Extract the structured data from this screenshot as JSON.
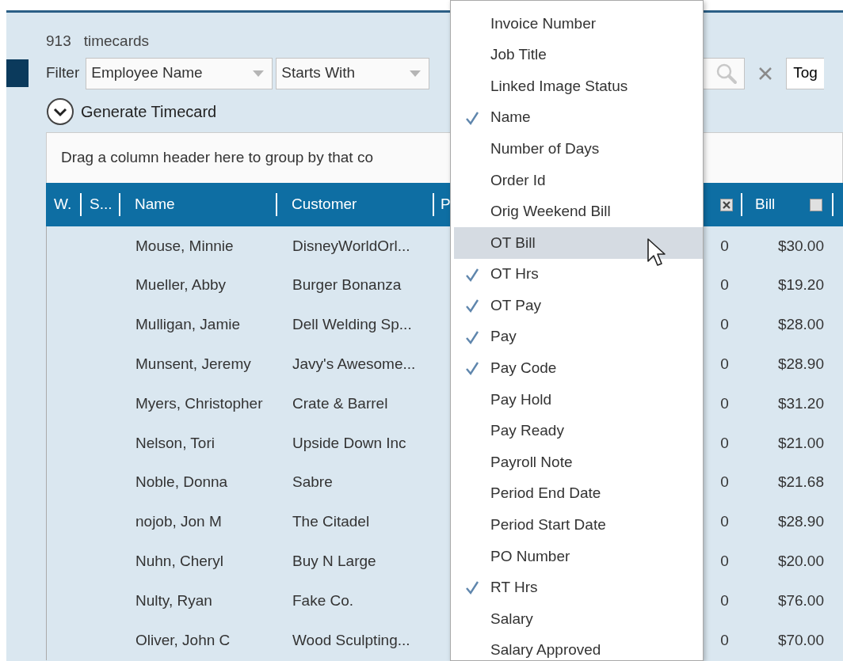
{
  "record_count": {
    "number": "913",
    "label": "timecards"
  },
  "filter": {
    "label": "Filter",
    "field": "Employee Name",
    "operator": "Starts With",
    "toggle_button": "Tog"
  },
  "generate_timecard": {
    "label": "Generate Timecard",
    "expanded": false
  },
  "group_by_hint": "Drag a column header here to group by that co",
  "table": {
    "columns_left": [
      "W.",
      "S...",
      "Name",
      "Customer",
      "P"
    ],
    "columns_right": [
      {
        "kind": "checkbox",
        "checked": true
      },
      {
        "kind": "text",
        "label": "Bill",
        "checked": false
      }
    ],
    "rows": [
      {
        "name": "Mouse, Minnie",
        "customer": "DisneyWorldOrl...",
        "column_6": "0",
        "bill": "$30.00"
      },
      {
        "name": "Mueller, Abby",
        "customer": "Burger Bonanza",
        "column_6": "0",
        "bill": "$19.20"
      },
      {
        "name": "Mulligan, Jamie",
        "customer": "Dell Welding Sp...",
        "column_6": "0",
        "bill": "$28.00"
      },
      {
        "name": "Munsent, Jeremy",
        "customer": "Javy's Awesome...",
        "column_6": "0",
        "bill": "$28.90"
      },
      {
        "name": "Myers, Christopher",
        "customer": "Crate & Barrel",
        "column_6": "0",
        "bill": "$31.20"
      },
      {
        "name": "Nelson, Tori",
        "customer": "Upside Down Inc",
        "column_6": "0",
        "bill": "$21.00"
      },
      {
        "name": "Noble, Donna",
        "customer": "Sabre",
        "column_6": "0",
        "bill": "$21.68"
      },
      {
        "name": "nojob, Jon M",
        "customer": "The Citadel",
        "column_6": "0",
        "bill": "$28.90"
      },
      {
        "name": "Nuhn, Cheryl",
        "customer": "Buy N Large",
        "column_6": "0",
        "bill": "$20.00"
      },
      {
        "name": "Nulty, Ryan",
        "customer": "Fake Co.",
        "column_6": "0",
        "bill": "$76.00"
      },
      {
        "name": "Oliver, John C",
        "customer": "Wood Sculpting...",
        "column_6": "0",
        "bill": "$70.00"
      }
    ]
  },
  "column_menu": [
    {
      "label": "Invoice Number",
      "checked": false,
      "selected": false
    },
    {
      "label": "Job Title",
      "checked": false,
      "selected": false
    },
    {
      "label": "Linked Image Status",
      "checked": false,
      "selected": false
    },
    {
      "label": "Name",
      "checked": true,
      "selected": false
    },
    {
      "label": "Number of Days",
      "checked": false,
      "selected": false
    },
    {
      "label": "Order Id",
      "checked": false,
      "selected": false
    },
    {
      "label": "Orig Weekend Bill",
      "checked": false,
      "selected": false
    },
    {
      "label": "OT Bill",
      "checked": false,
      "selected": true
    },
    {
      "label": "OT Hrs",
      "checked": true,
      "selected": false
    },
    {
      "label": "OT Pay",
      "checked": true,
      "selected": false
    },
    {
      "label": "Pay",
      "checked": true,
      "selected": false
    },
    {
      "label": "Pay Code",
      "checked": true,
      "selected": false
    },
    {
      "label": "Pay Hold",
      "checked": false,
      "selected": false
    },
    {
      "label": "Pay Ready",
      "checked": false,
      "selected": false
    },
    {
      "label": "Payroll Note",
      "checked": false,
      "selected": false
    },
    {
      "label": "Period End Date",
      "checked": false,
      "selected": false
    },
    {
      "label": "Period Start Date",
      "checked": false,
      "selected": false
    },
    {
      "label": "PO Number",
      "checked": false,
      "selected": false
    },
    {
      "label": "RT Hrs",
      "checked": true,
      "selected": false
    },
    {
      "label": "Salary",
      "checked": false,
      "selected": false
    },
    {
      "label": "Salary Approved",
      "checked": false,
      "selected": false
    }
  ]
}
